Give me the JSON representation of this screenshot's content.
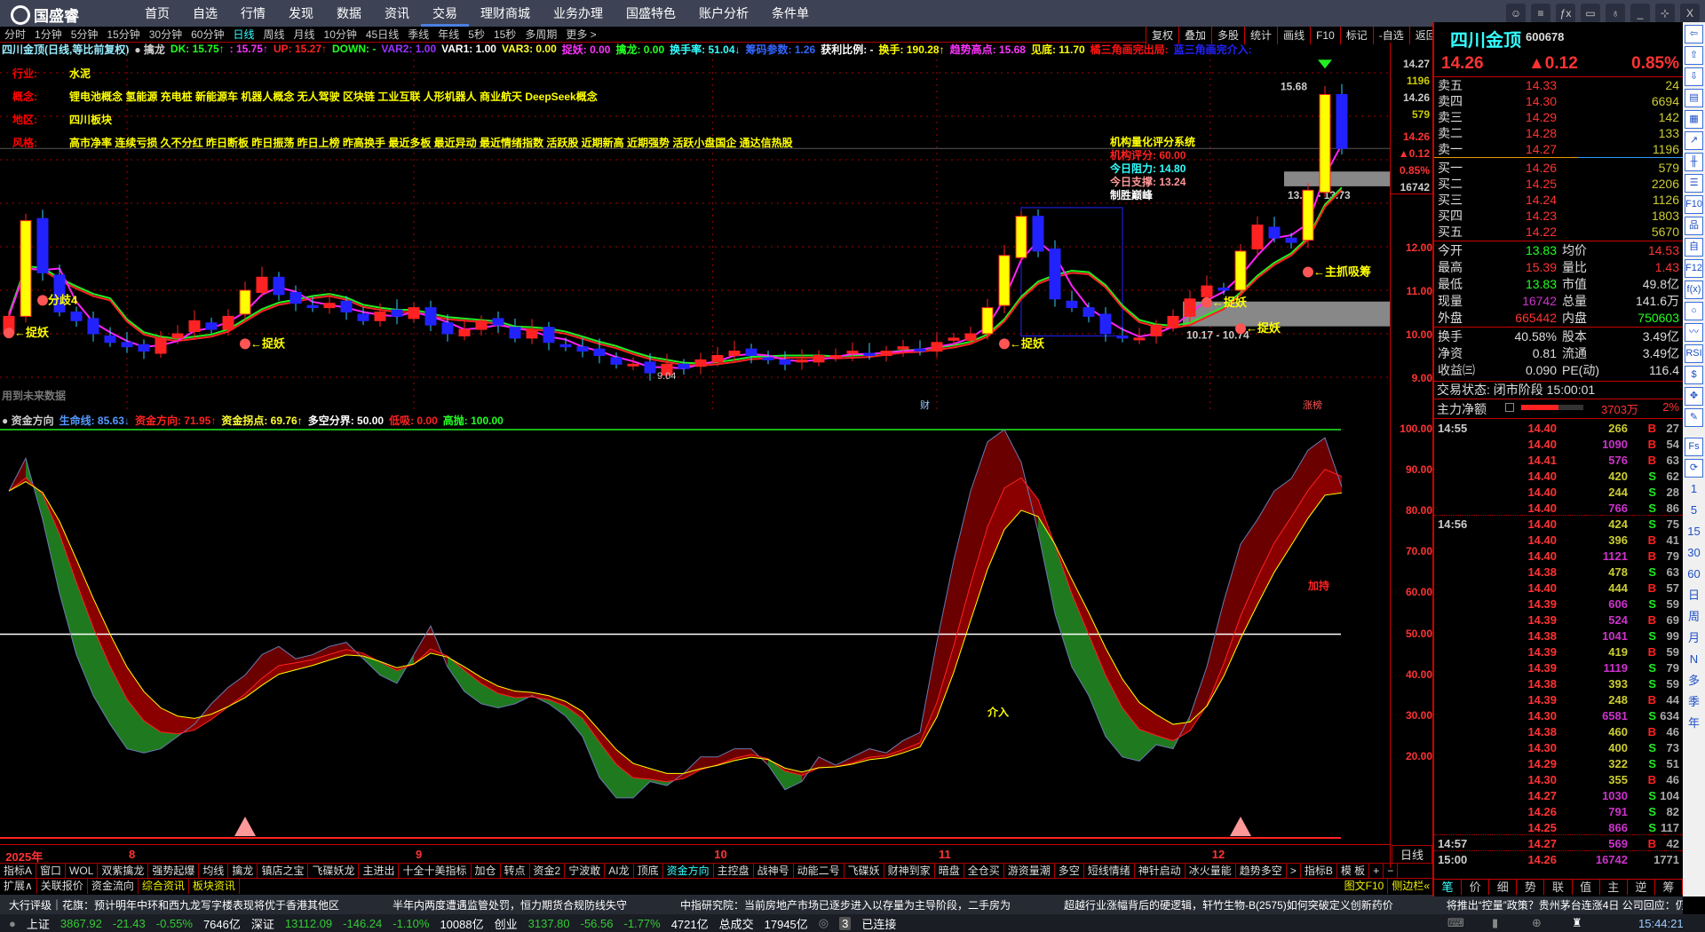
{
  "app": {
    "name": "国盛睿"
  },
  "nav": [
    "首页",
    "自选",
    "行情",
    "发现",
    "数据",
    "资讯",
    "交易",
    "理财商城",
    "业务办理",
    "国盛特色",
    "账户分析",
    "条件单"
  ],
  "nav_active": 6,
  "window_controls": [
    "message-icon",
    "settings-icon",
    "fx-icon",
    "screen-icon",
    "skin-icon",
    "minimize-icon",
    "restore-icon",
    "close-icon"
  ],
  "window_glyphs": [
    "☺",
    "≡",
    "ƒx",
    "▭",
    "♁",
    "_",
    "⊹",
    "X"
  ],
  "periods": [
    "分时",
    "1分钟",
    "5分钟",
    "15分钟",
    "30分钟",
    "60分钟",
    "日线",
    "周线",
    "月线",
    "10分钟",
    "45日线",
    "季线",
    "年线",
    "5秒",
    "15秒",
    "多周期",
    "更多 >"
  ],
  "period_active": 6,
  "tools": [
    "复权",
    "叠加",
    "多股",
    "统计",
    "画线",
    "F10",
    "标记",
    "-自选",
    "返回"
  ],
  "indicator_main": [
    {
      "t": "四川金顶(日线,等比前复权)",
      "c": "#9ef"
    },
    {
      "t": "● 擒龙",
      "c": "#ccc"
    },
    {
      "t": "DK: 15.75↑",
      "c": "#2f2"
    },
    {
      "t": ": 15.75↑",
      "c": "#f3f"
    },
    {
      "t": "UP: 15.27↑",
      "c": "#f22"
    },
    {
      "t": "DOWN: -",
      "c": "#2f2"
    },
    {
      "t": "VAR2: 1.00",
      "c": "#93f"
    },
    {
      "t": "VAR1: 1.00",
      "c": "#fff"
    },
    {
      "t": "VAR3: 0.00",
      "c": "#ff3"
    },
    {
      "t": "捉妖: 0.00",
      "c": "#f3f"
    },
    {
      "t": "擒龙: 0.00",
      "c": "#2f2"
    },
    {
      "t": "换手率: 51.04↓",
      "c": "#3ff"
    },
    {
      "t": "筹码参数: 1.26",
      "c": "#36f"
    },
    {
      "t": "获利比例: -",
      "c": "#fff"
    },
    {
      "t": "换手: 190.28↑",
      "c": "#ff0"
    },
    {
      "t": "趋势高点: 15.68",
      "c": "#f3f"
    },
    {
      "t": "见底: 11.70",
      "c": "#ff0"
    },
    {
      "t": "橘三角画完出局:",
      "c": "#f11"
    },
    {
      "t": "蓝三角画完介入:",
      "c": "#22f"
    }
  ],
  "indicator_low": [
    {
      "t": "● 资金方向",
      "c": "#ccc"
    },
    {
      "t": "生命线: 85.63↓",
      "c": "#59f"
    },
    {
      "t": "资金方向: 71.95↑",
      "c": "#f22"
    },
    {
      "t": "资金拐点: 69.76↑",
      "c": "#ff3"
    },
    {
      "t": "多空分界: 50.00",
      "c": "#fff"
    },
    {
      "t": "低吸: 0.00",
      "c": "#f22"
    },
    {
      "t": "高抛: 100.00",
      "c": "#2f2"
    }
  ],
  "info": [
    {
      "k": "行业:",
      "v": "水泥"
    },
    {
      "k": "概念:",
      "v": "锂电池概念 氢能源 充电桩 新能源车 机器人概念 无人驾驶 区块链 工业互联 人形机器人 商业航天 DeepSeek概念"
    },
    {
      "k": "地区:",
      "v": "四川板块"
    },
    {
      "k": "风格:",
      "v": "高市净率 连续亏损 久不分红 昨日断板 昨日振荡 昨日上榜 昨高换手 最近多板 最近异动 最近情绪指数 活跃股 近期新高 近期强势 活跃小盘国企 通达信热股"
    }
  ],
  "inst": {
    "title": "机构量化评分系统",
    "score_label": "机构评分:",
    "score": "60.00",
    "res_label": "今日阻力:",
    "res": "14.80",
    "sup_label": "今日支撑:",
    "sup": "13.24",
    "foot": "制胜巅峰"
  },
  "future_note": "用到未来数据",
  "main_axis": {
    "ask1": "14.27",
    "ask1_vol": "1196",
    "bid1": "14.26",
    "bid1_vol": "579",
    "last": "14.26",
    "chg": "▲0.12",
    "pct": "0.85%",
    "vol": "16742",
    "ticks": [
      "12.00",
      "11.00",
      "10.00",
      "9.00"
    ]
  },
  "low_axis": [
    "100.00",
    "90.00",
    "80.00",
    "70.00",
    "60.00",
    "50.00",
    "40.00",
    "30.00",
    "20.00"
  ],
  "chart": {
    "closes": [
      10.4,
      12.6,
      11.4,
      10.5,
      10.3,
      10.0,
      9.8,
      9.7,
      9.6,
      9.9,
      10.0,
      10.3,
      10.1,
      10.4,
      11.0,
      11.3,
      10.9,
      10.7,
      10.6,
      10.7,
      10.5,
      10.3,
      10.5,
      10.4,
      10.6,
      10.2,
      10.0,
      10.1,
      10.3,
      10.2,
      9.9,
      10.1,
      9.8,
      9.7,
      9.6,
      9.5,
      9.3,
      9.3,
      9.1,
      9.3,
      9.2,
      9.4,
      9.5,
      9.6,
      9.5,
      9.4,
      9.3,
      9.4,
      9.5,
      9.5,
      9.6,
      9.5,
      9.6,
      9.7,
      9.6,
      9.8,
      9.9,
      10.0,
      10.6,
      11.8,
      12.7,
      11.9,
      10.8,
      10.6,
      10.4,
      10.0,
      9.9,
      9.9,
      10.2,
      10.4,
      10.8,
      11.1,
      11.0,
      11.9,
      12.5,
      12.2,
      12.1,
      13.3,
      15.5,
      14.26
    ],
    "fund_direction": [
      85,
      93,
      78,
      60,
      45,
      35,
      28,
      22,
      21,
      22,
      25,
      28,
      33,
      37,
      40,
      45,
      47,
      44,
      45,
      47,
      48,
      44,
      40,
      38,
      45,
      52,
      42,
      36,
      33,
      32,
      33,
      35,
      33,
      30,
      25,
      15,
      10,
      10,
      14,
      13,
      16,
      20,
      20,
      22,
      22,
      18,
      12,
      14,
      20,
      18,
      20,
      22,
      21,
      24,
      26,
      48,
      68,
      85,
      97,
      100,
      92,
      75,
      55,
      42,
      35,
      25,
      20,
      19,
      23,
      22,
      30,
      42,
      58,
      72,
      78,
      85,
      88,
      95,
      98,
      86
    ],
    "high_label": "15.68",
    "low_label": "9.04",
    "zones": [
      {
        "text": "13.39 - 13.73",
        "lo": 13.39,
        "hi": 13.73,
        "from": 76
      },
      {
        "text": "10.17 - 10.74",
        "lo": 10.17,
        "hi": 10.74,
        "from": 70
      }
    ],
    "signals": [
      {
        "i": 0,
        "t": "←捉妖",
        "p": 10.1
      },
      {
        "i": 2,
        "t": "分歧4",
        "p": 10.85
      },
      {
        "i": 14,
        "t": "←捉妖",
        "p": 9.85
      },
      {
        "i": 59,
        "t": "←捉妖",
        "p": 9.85
      },
      {
        "i": 71,
        "t": "←捉妖",
        "p": 10.8
      },
      {
        "i": 73,
        "t": "←捉妖",
        "p": 10.2
      },
      {
        "i": 77,
        "t": "←主抓吸筹",
        "p": 11.5
      }
    ],
    "low_labels": [
      {
        "i": 58,
        "t": "介入",
        "v": 30
      },
      {
        "i": 77,
        "t": "加持",
        "v": 61
      }
    ],
    "months": [
      {
        "t": "2025年",
        "i": -0.3
      },
      {
        "t": "8",
        "i": 7
      },
      {
        "t": "9",
        "i": 24
      },
      {
        "t": "10",
        "i": 41.7
      },
      {
        "t": "11",
        "i": 55
      },
      {
        "t": "12",
        "i": 71.2
      }
    ],
    "bottom_marks": [
      "财",
      "涨榜"
    ]
  },
  "period_label": "日线",
  "tabs": [
    "指标A",
    "窗口",
    "WOL",
    "双紫擒龙",
    "强势起爆",
    "均线",
    "擒龙",
    "镇店之宝",
    "飞碟妖龙",
    "主进出",
    "十全十美指标",
    "加仓",
    "转点",
    "资金2",
    "宁波敢",
    "AI龙",
    "顶底",
    "资金方向",
    "主控盘",
    "战神号",
    "动能二号",
    "飞碟妖",
    "财神到家",
    "暗盘",
    "全仓买",
    "游资量潮",
    "多空",
    "短线情绪",
    "神针启动",
    "冰火量能",
    "趋势多空",
    ">",
    "指标B",
    "模 板",
    "+",
    "−"
  ],
  "tab_active": 17,
  "ext": [
    "扩展∧",
    "关联报价",
    "资金流向",
    "综合资讯",
    "板块资讯",
    "图文F10",
    "侧边栏«"
  ],
  "news": [
    "大行评级｜花旗：预计明年中环和西九龙写字楼表现将优于香港其他区",
    "半年内两度遭遇监管处罚，恒力期货合规防线失守",
    "中指研究院：当前房地产市场已逐步进入以存量为主导阶段，二手房为",
    "超越行业涨幅背后的硬逻辑，轩竹生物-B(2575)如何突破定义创新药价",
    "将推出“控量”政策？贵州茅台连涨4日 公司回应：仍在研究中"
  ],
  "status": {
    "sh": "上证",
    "sh_v": "3867.92",
    "sh_c": "-21.43",
    "sh_p": "-0.55%",
    "sh_a": "7646亿",
    "sz": "深证",
    "sz_v": "13112.09",
    "sz_c": "-146.24",
    "sz_p": "-1.10%",
    "sz_a": "10088亿",
    "cy": "创业",
    "cy_v": "3137.80",
    "cy_c": "-56.56",
    "cy_p": "-1.77%",
    "cy_a": "4721亿",
    "tot": "总成交",
    "tot_a": "17945亿",
    "conn_n": "3",
    "conn": "已连接",
    "time": "15:44:21"
  },
  "quote": {
    "name": "四川金顶",
    "code": "600678",
    "price": "14.26",
    "chg": "▲0.12",
    "pct": "0.85%",
    "asks": [
      {
        "l": "卖五",
        "p": "14.33",
        "v": "24"
      },
      {
        "l": "卖四",
        "p": "14.30",
        "v": "6694"
      },
      {
        "l": "卖三",
        "p": "14.29",
        "v": "142"
      },
      {
        "l": "卖二",
        "p": "14.28",
        "v": "133"
      },
      {
        "l": "卖一",
        "p": "14.27",
        "v": "1196"
      }
    ],
    "bids": [
      {
        "l": "买一",
        "p": "14.26",
        "v": "579"
      },
      {
        "l": "买二",
        "p": "14.25",
        "v": "2206"
      },
      {
        "l": "买三",
        "p": "14.24",
        "v": "1126"
      },
      {
        "l": "买四",
        "p": "14.23",
        "v": "1803"
      },
      {
        "l": "买五",
        "p": "14.22",
        "v": "5670"
      }
    ],
    "stats": [
      {
        "a": "今开",
        "av": "13.83",
        "ac": "#2f2",
        "b": "均价",
        "bv": "14.53",
        "bc": "#f33"
      },
      {
        "a": "最高",
        "av": "15.39",
        "ac": "#f33",
        "b": "量比",
        "bv": "1.43",
        "bc": "#f33"
      },
      {
        "a": "最低",
        "av": "13.83",
        "ac": "#2f2",
        "b": "市值",
        "bv": "49.8亿",
        "bc": "#ddd"
      },
      {
        "a": "现量",
        "av": "16742",
        "ac": "#c3c",
        "b": "总量",
        "bv": "141.6万",
        "bc": "#ddd"
      },
      {
        "a": "外盘",
        "av": "665442",
        "ac": "#f33",
        "b": "内盘",
        "bv": "750603",
        "bc": "#2f2"
      }
    ],
    "stats2": [
      {
        "a": "换手",
        "av": "40.58%",
        "ac": "#ddd",
        "b": "股本",
        "bv": "3.49亿",
        "bc": "#ddd"
      },
      {
        "a": "净资",
        "av": "0.81",
        "ac": "#ddd",
        "b": "流通",
        "bv": "3.49亿",
        "bc": "#ddd"
      },
      {
        "a": "收益㈢",
        "av": "0.090",
        "ac": "#ddd",
        "b": "PE(动)",
        "bv": "116.4",
        "bc": "#ddd"
      }
    ],
    "trade_status": "交易状态: 闭市阶段 15:00:01",
    "net_label": "主力净额",
    "net": "3703万",
    "net_pct": "2%",
    "net_fill": 0.6
  },
  "ticks": [
    [
      "14:55",
      "14.40",
      "266",
      "B",
      "27"
    ],
    [
      "",
      "14.40",
      "1090",
      "B",
      "54"
    ],
    [
      "",
      "14.41",
      "576",
      "B",
      "63"
    ],
    [
      "",
      "14.40",
      "420",
      "S",
      "62"
    ],
    [
      "",
      "14.40",
      "244",
      "S",
      "28"
    ],
    [
      "",
      "14.40",
      "766",
      "S",
      "86"
    ],
    [
      "14:56",
      "14.40",
      "424",
      "S",
      "75"
    ],
    [
      "",
      "14.40",
      "396",
      "B",
      "41"
    ],
    [
      "",
      "14.40",
      "1121",
      "B",
      "79"
    ],
    [
      "",
      "14.38",
      "478",
      "S",
      "63"
    ],
    [
      "",
      "14.40",
      "444",
      "B",
      "57"
    ],
    [
      "",
      "14.39",
      "606",
      "S",
      "59"
    ],
    [
      "",
      "14.39",
      "524",
      "B",
      "69"
    ],
    [
      "",
      "14.38",
      "1041",
      "S",
      "99"
    ],
    [
      "",
      "14.39",
      "419",
      "B",
      "59"
    ],
    [
      "",
      "14.39",
      "1119",
      "S",
      "79"
    ],
    [
      "",
      "14.38",
      "393",
      "S",
      "59"
    ],
    [
      "",
      "14.39",
      "248",
      "B",
      "44"
    ],
    [
      "",
      "14.30",
      "6581",
      "S",
      "634"
    ],
    [
      "",
      "14.38",
      "460",
      "B",
      "46"
    ],
    [
      "",
      "14.30",
      "400",
      "S",
      "73"
    ],
    [
      "",
      "14.29",
      "322",
      "S",
      "51"
    ],
    [
      "",
      "14.30",
      "355",
      "B",
      "46"
    ],
    [
      "",
      "14.27",
      "1030",
      "S",
      "104"
    ],
    [
      "",
      "14.26",
      "791",
      "S",
      "82"
    ],
    [
      "",
      "14.25",
      "866",
      "S",
      "117"
    ],
    [
      "14:57",
      "14.27",
      "569",
      "B",
      "42"
    ],
    [
      "15:00",
      "14.26",
      "16742",
      "",
      "1771"
    ]
  ],
  "tick_tabs": [
    "笔",
    "价",
    "细",
    "势",
    "联",
    "值",
    "主",
    "逆",
    "筹"
  ],
  "sidebar_top": [
    "⇦",
    "⇧",
    "⇩",
    "▤",
    "▦",
    "↗",
    "╫",
    "☰",
    "F10",
    "品",
    "自",
    "F12",
    "f(x)",
    "○",
    "〰",
    "RSI",
    "$",
    "✥",
    "✎"
  ],
  "sidebar_bottom": [
    "Fs",
    "⟳",
    "1",
    "5",
    "15",
    "30",
    "60",
    "日",
    "周",
    "月",
    "N",
    "多",
    "季",
    "年"
  ]
}
